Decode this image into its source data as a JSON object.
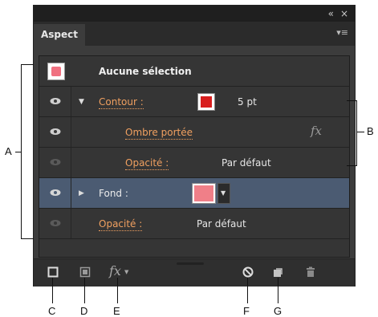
{
  "panel": {
    "tab_label": "Aspect",
    "collapse_glyph": "«",
    "close_glyph": "×",
    "menu_glyph": "▾≡"
  },
  "rows": {
    "header": {
      "label": "Aucune sélection",
      "swatch_color": "#f07080"
    },
    "contour": {
      "label": "Contour :",
      "value": "5 pt",
      "swatch_color": "#d81e1e"
    },
    "ombre": {
      "label": "Ombre portée",
      "fx_glyph": "fx"
    },
    "opacite1": {
      "label": "Opacité :",
      "value": "Par défaut"
    },
    "fond": {
      "label": "Fond :",
      "swatch_color": "#f07f88"
    },
    "opacite2": {
      "label": "Opacité :",
      "value": "Par défaut"
    }
  },
  "bottom": {
    "fx_glyph": "fx"
  },
  "callouts": {
    "A": "A",
    "B": "B",
    "C": "C",
    "D": "D",
    "E": "E",
    "F": "F",
    "G": "G"
  },
  "colors": {
    "link": "#f0a060",
    "selected_row": "#4b5b72",
    "panel_bg": "#3c3c3c"
  },
  "icons": [
    "eye-icon",
    "expand-triangle-icon",
    "fx-icon",
    "new-stroke-icon",
    "new-fill-icon",
    "clear-appearance-icon",
    "duplicate-item-icon",
    "trash-icon",
    "panel-menu-icon",
    "collapse-icon",
    "close-icon"
  ]
}
